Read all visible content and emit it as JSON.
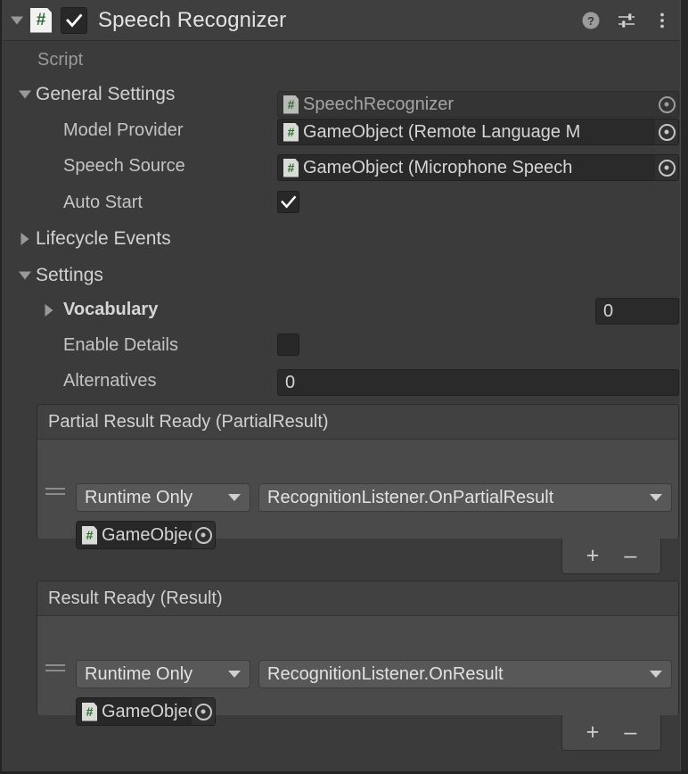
{
  "component": {
    "title": "Speech Recognizer",
    "enabled_checkbox": true,
    "script_icon": "script-hash-icon",
    "foldout_expanded": true,
    "header_icons": [
      {
        "name": "help-icon",
        "label": "?"
      },
      {
        "name": "preset-icon",
        "label": "preset"
      },
      {
        "name": "more-menu-icon",
        "label": "⋮"
      }
    ]
  },
  "script_row": {
    "label": "Script",
    "value": "SpeechRecognizer"
  },
  "general_settings": {
    "header": "General Settings",
    "expanded": true,
    "model_provider": {
      "label": "Model Provider",
      "value": "GameObject (Remote Language M"
    },
    "speech_source": {
      "label": "Speech Source",
      "value": "GameObject (Microphone Speech"
    },
    "auto_start": {
      "label": "Auto Start",
      "checked": true
    }
  },
  "lifecycle_events": {
    "header": "Lifecycle Events",
    "expanded": false
  },
  "settings": {
    "header": "Settings",
    "expanded": true,
    "vocabulary": {
      "label": "Vocabulary",
      "value": "0",
      "expanded": false
    },
    "enable_details": {
      "label": "Enable Details",
      "checked": false
    },
    "alternatives": {
      "label": "Alternatives",
      "value": "0"
    }
  },
  "events": [
    {
      "title": "Partial Result Ready (PartialResult)",
      "call_mode": "Runtime Only",
      "function": "RecognitionListener.OnPartialResult",
      "target_object": "GameObjec",
      "add_label": "+",
      "remove_label": "–"
    },
    {
      "title": "Result Ready (Result)",
      "call_mode": "Runtime Only",
      "function": "RecognitionListener.OnResult",
      "target_object": "GameObjec",
      "add_label": "+",
      "remove_label": "–"
    }
  ],
  "colors": {
    "panel_bg": "#3b3b3b",
    "header_bg": "#3f3f3f",
    "field_bg": "#2a2a2a",
    "event_bg": "#4a4a4a",
    "dropdown_bg": "#585858",
    "text": "#c4c4c4",
    "script_green": "#2d6a2d"
  }
}
